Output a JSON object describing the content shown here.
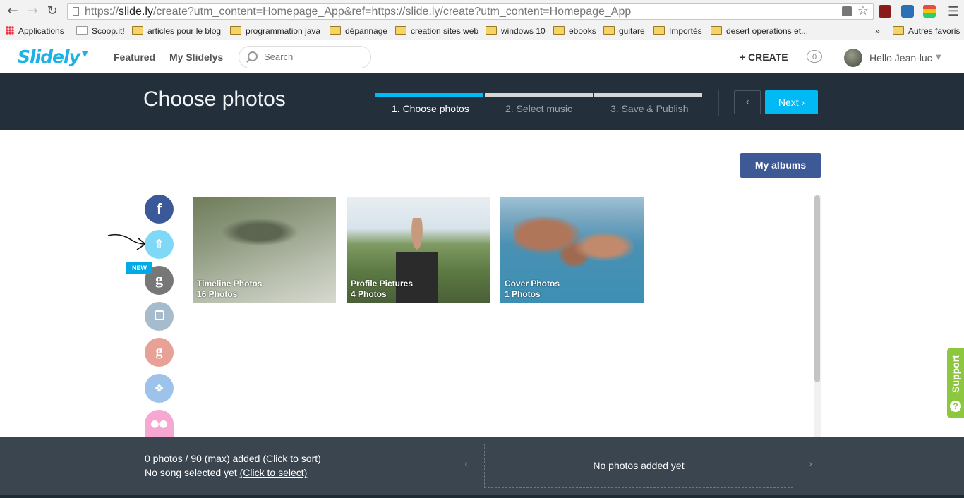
{
  "browser": {
    "url_prefix": "https://",
    "url_domain": "slide.ly",
    "url_rest": "/create?utm_content=Homepage_App&ref=https://slide.ly/create?utm_content=Homepage_App",
    "bookmarks": [
      "Applications",
      "Scoop.it!",
      "articles pour le blog",
      "programmation java",
      "dépannage",
      "creation sites web",
      "windows 10",
      "ebooks",
      "guitare",
      "Importés",
      "desert operations et..."
    ],
    "more_label": "»",
    "other_bookmarks": "Autres favoris"
  },
  "site_header": {
    "logo": "Slidely",
    "nav": [
      "Featured",
      "My Slidelys"
    ],
    "search_placeholder": "Search",
    "create_label": "+ CREATE",
    "notifications_count": "0",
    "user_greeting": "Hello Jean-luc"
  },
  "topbar": {
    "title": "Choose photos",
    "steps": [
      {
        "label": "1. Choose photos",
        "active": true
      },
      {
        "label": "2. Select music",
        "active": false
      },
      {
        "label": "3. Save & Publish",
        "active": false
      }
    ],
    "next_label": "Next ›",
    "prev_label": "‹"
  },
  "content": {
    "my_albums_label": "My albums",
    "new_badge": "NEW",
    "sources": [
      "facebook",
      "upload",
      "getty",
      "instagram",
      "google",
      "dropbox",
      "flickr"
    ],
    "albums": [
      {
        "name": "Timeline Photos",
        "count": "16  Photos"
      },
      {
        "name": "Profile Pictures",
        "count": "4  Photos"
      },
      {
        "name": "Cover Photos",
        "count": "1  Photos"
      }
    ],
    "support_label": "Support"
  },
  "footer": {
    "photos_text": "0 photos / 90 (max) added ",
    "sort_link": "(Click to sort)",
    "song_text": "No song selected yet ",
    "select_link": "(Click to select)",
    "empty_text": "No photos added yet"
  },
  "colors": {
    "accent": "#00b9f5",
    "dark_bar": "#232f3b",
    "footer_bg": "#3b454f",
    "albums_button": "#3d5a97",
    "support_green": "#8dc63f"
  }
}
